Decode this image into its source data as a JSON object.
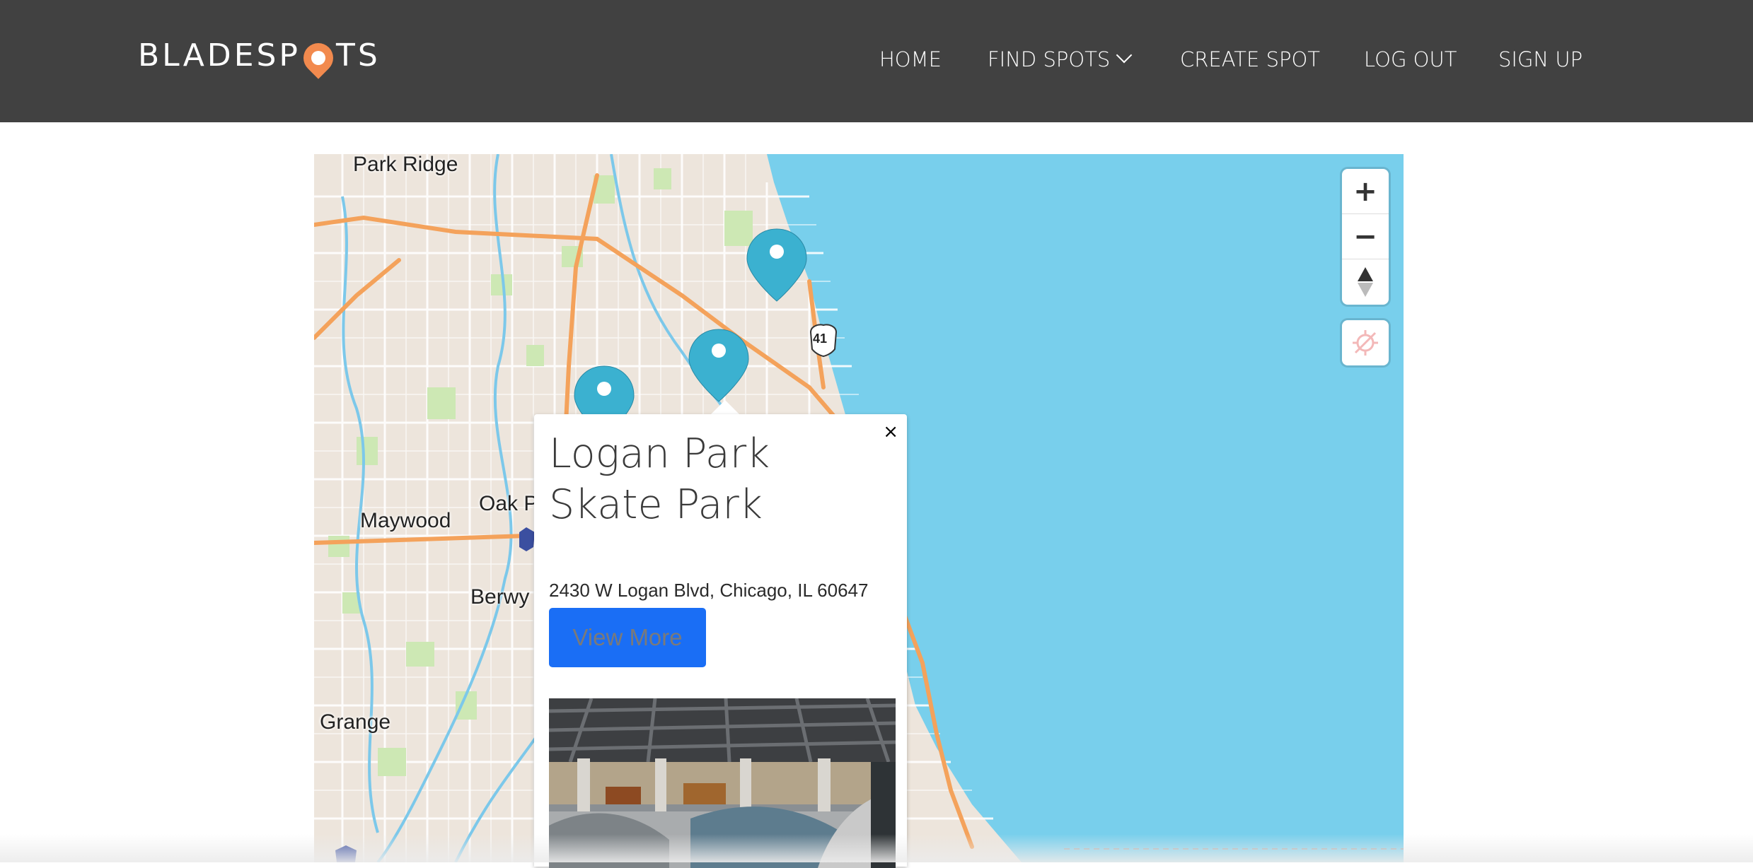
{
  "brand": {
    "logo_text_left": "BLADESP",
    "logo_text_right": "TS"
  },
  "nav": {
    "home": "HOME",
    "find_spots": "FIND SPOTS",
    "create_spot": "CREATE SPOT",
    "log_out": "LOG OUT",
    "sign_up": "SIGN UP"
  },
  "map": {
    "labels": {
      "park_ridge": "Park Ridge",
      "maywood": "Maywood",
      "oak_park": "Oak P",
      "berwyn": "Berwy",
      "grange": "Grange",
      "highway_41": "41"
    },
    "controls": {
      "zoom_in": "+",
      "zoom_out": "−"
    }
  },
  "popup": {
    "close": "×",
    "title": "Logan Park Skate Park",
    "address": "2430 W Logan Blvd, Chicago, IL 60647",
    "button": "View More"
  },
  "colors": {
    "navbar": "#414141",
    "lake": "#78cfec",
    "land": "#ede5dc",
    "highway": "#f4a25b",
    "park": "#cde8b4",
    "marker": "#3bb1d0",
    "button": "#1a6ef5",
    "logo_pin": "#f28a4e"
  }
}
